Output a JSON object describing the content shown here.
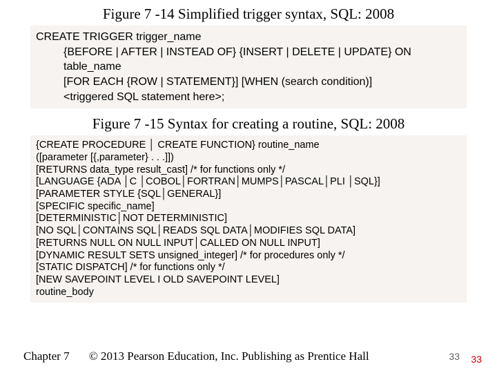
{
  "caption1": "Figure 7 -14 Simplified trigger syntax, SQL: 2008",
  "block1": {
    "l1": "CREATE TRIGGER trigger_name",
    "l2": "{BEFORE | AFTER | INSTEAD OF} {INSERT | DELETE | UPDATE} ON",
    "l3": "table_name",
    "l4": "[FOR EACH {ROW | STATEMENT}] [WHEN (search condition)]",
    "l5": "<triggered SQL statement here>;"
  },
  "caption2": "Figure 7 -15 Syntax for creating a routine, SQL: 2008",
  "block2": {
    "l1": "{CREATE PROCEDURE │ CREATE FUNCTION} routine_name",
    "l2": "([parameter [{,parameter} . . .]])",
    "l3": "[RETURNS data_type result_cast]    /* for functions only */",
    "l4": "[LANGUAGE {ADA │C │COBOL│FORTRAN│MUMPS│PASCAL│PLI │SQL}]",
    "l5": "[PARAMETER STYLE {SQL│GENERAL}]",
    "l6": "[SPECIFIC specific_name]",
    "l7": "[DETERMINISTIC│NOT DETERMINISTIC]",
    "l8": "[NO SQL│CONTAINS SQL│READS SQL DATA│MODIFIES SQL DATA]",
    "l9": "[RETURNS NULL ON NULL INPUT│CALLED ON NULL INPUT]",
    "l10": "[DYNAMIC RESULT SETS unsigned_integer]              /* for procedures only */",
    "l11": "[STATIC DISPATCH]                                               /* for functions only */",
    "l12": "[NEW SAVEPOINT LEVEL I OLD SAVEPOINT LEVEL]",
    "l13": "routine_body"
  },
  "footer": {
    "chapter": "Chapter 7",
    "copy": "© 2013 Pearson Education, Inc.  Publishing as Prentice Hall"
  },
  "page": {
    "dark": "33",
    "red": "33"
  }
}
